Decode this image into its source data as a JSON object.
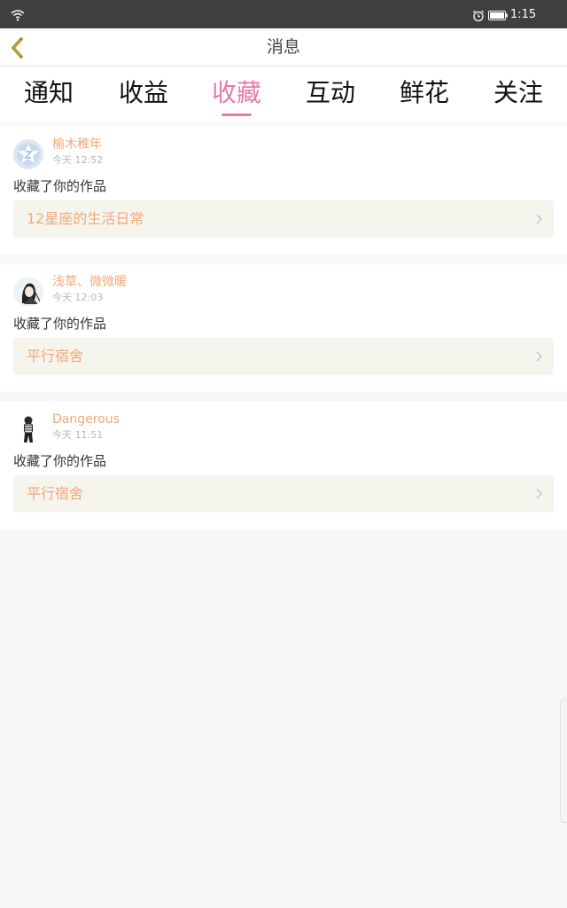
{
  "status_bar": {
    "time": "1:15"
  },
  "header": {
    "title": "消息"
  },
  "tabs": [
    {
      "label": "通知"
    },
    {
      "label": "收益"
    },
    {
      "label": "收藏"
    },
    {
      "label": "互动"
    },
    {
      "label": "鲜花"
    },
    {
      "label": "关注"
    }
  ],
  "active_tab": "收藏",
  "colors": {
    "accent": "#e879a8",
    "username": "#f0a97a",
    "status_bar": "#3f3f3f",
    "work_bg": "#f5f5ee"
  },
  "feed": [
    {
      "username": "榆木稚年",
      "time": "今天 12:52",
      "action": "收藏了你的作品",
      "work_title": "12星座的生活日常",
      "avatar_icon": "default-star-avatar"
    },
    {
      "username": "浅草、微微暖",
      "time": "今天 12:03",
      "action": "收藏了你的作品",
      "work_title": "平行宿舍",
      "avatar_icon": "anime-girl-avatar"
    },
    {
      "username": "Dangerous",
      "time": "今天 11:51",
      "action": "收藏了你的作品",
      "work_title": "平行宿舍",
      "avatar_icon": "anime-figure-avatar"
    }
  ]
}
